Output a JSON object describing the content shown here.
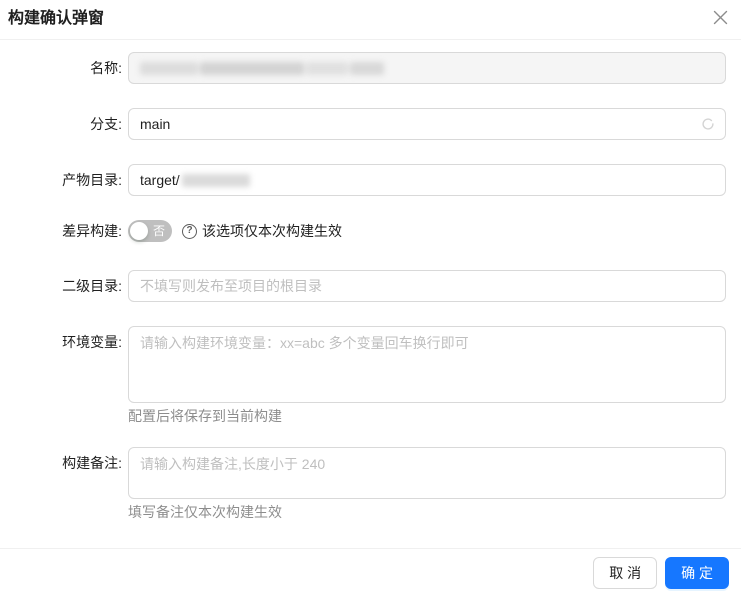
{
  "dialog": {
    "title": "构建确认弹窗"
  },
  "form": {
    "name": {
      "label": "名称:",
      "value_redacted": true
    },
    "branch": {
      "label": "分支:",
      "value": "main"
    },
    "artifact_dir": {
      "label": "产物目录:",
      "value_prefix": "target/",
      "suffix_redacted": true
    },
    "diff_build": {
      "label": "差异构建:",
      "switch_state": "off",
      "switch_text": "否",
      "help_text": "该选项仅本次构建生效"
    },
    "sub_dir": {
      "label": "二级目录:",
      "placeholder": "不填写则发布至项目的根目录"
    },
    "env_vars": {
      "label": "环境变量:",
      "placeholder": "请输入构建环境变量：xx=abc 多个变量回车换行即可",
      "hint": "配置后将保存到当前构建"
    },
    "build_note": {
      "label": "构建备注:",
      "placeholder": "请输入构建备注,长度小于 240",
      "hint": "填写备注仅本次构建生效"
    }
  },
  "icons": {
    "question_glyph": "?"
  },
  "footer": {
    "cancel_label": "取 消",
    "confirm_label": "确 定"
  },
  "colors": {
    "primary": "#1677ff",
    "border": "#d9d9d9",
    "divider": "#f0f0f0",
    "placeholder": "#bfbfbf",
    "switch_off_bg": "#bfbfbf",
    "disabled_bg": "#f5f5f5",
    "hint_text": "#737373"
  }
}
